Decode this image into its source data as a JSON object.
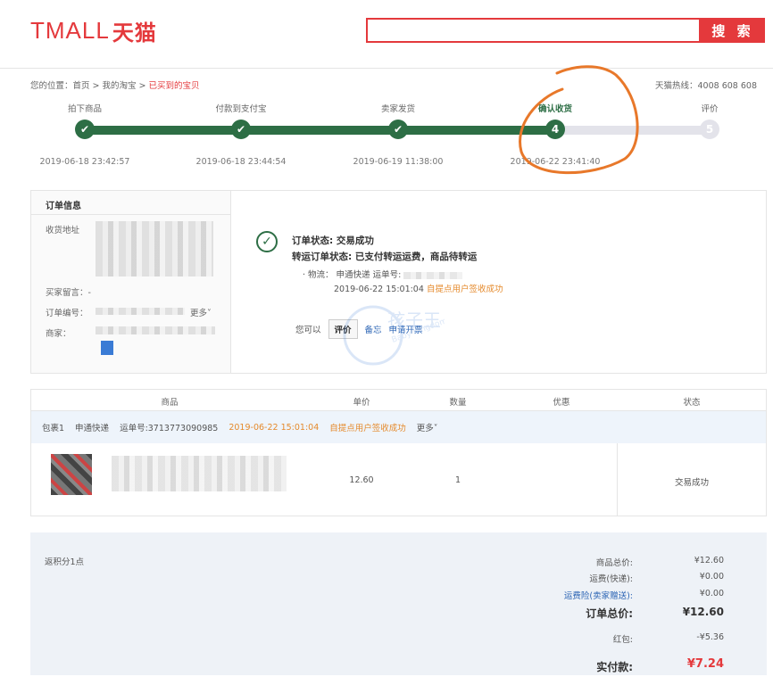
{
  "header": {
    "logo_latin": "TMALL",
    "logo_cn": "天猫",
    "search_placeholder": "",
    "search_button": "搜 索"
  },
  "breadcrumb": {
    "prefix": "您的位置：首页 > 我的淘宝 > ",
    "current": "已买到的宝贝",
    "hotline": "天猫热线：4008 608 608"
  },
  "steps": [
    {
      "label": "拍下商品",
      "time": "2019-06-18 23:42:57",
      "num": "✔",
      "done": true
    },
    {
      "label": "付款到支付宝",
      "time": "2019-06-18 23:44:54",
      "num": "✔",
      "done": true
    },
    {
      "label": "卖家发货",
      "time": "2019-06-19 11:38:00",
      "num": "✔",
      "done": true
    },
    {
      "label": "确认收货",
      "time": "2019-06-22 23:41:40",
      "num": "4",
      "done": true
    },
    {
      "label": "评价",
      "time": "",
      "num": "5",
      "done": false
    }
  ],
  "order_info": {
    "title": "订单信息",
    "address_label": "收货地址",
    "message_label": "买家留言：-",
    "order_no_label": "订单编号：",
    "more": "更多˅",
    "merchant_label": "商家："
  },
  "status": {
    "line1": "订单状态: 交易成功",
    "line2": "转运订单状态: 已支付转运运费，商品待转运",
    "logistics_prefix": "· 物流： 申通快递  运单号:",
    "logistics_time": "2019-06-22 15:01:04",
    "logistics_status": "自提点用户签收成功",
    "you_can": "您可以",
    "btn_eval": "评价",
    "link_memo": "备忘",
    "link_invoice": "申请开票"
  },
  "table": {
    "headers": [
      "商品",
      "单价",
      "数量",
      "优惠",
      "状态"
    ],
    "package": {
      "label": "包裹1",
      "carrier": "申通快递",
      "tracking": "运单号:3713773090985",
      "time": "2019-06-22 15:01:04",
      "status": "自提点用户签收成功",
      "more": "更多˅"
    },
    "row": {
      "price": "12.60",
      "qty": "1",
      "discount": "",
      "status": "交易成功"
    }
  },
  "summary": {
    "points": "返积分1点",
    "items": [
      {
        "label": "商品总价:",
        "value": "¥12.60"
      },
      {
        "label": "运费(快递):",
        "value": "¥0.00"
      },
      {
        "label": "运费险(卖家赠送):",
        "value": "¥0.00"
      },
      {
        "label": "订单总价:",
        "value": "¥12.60"
      },
      {
        "label": "红包:",
        "value": "-¥5.36"
      },
      {
        "label": "实付款:",
        "value": "¥7.24"
      }
    ]
  },
  "watermark": {
    "cn": "孩子王",
    "en": "Baby Kingdom"
  },
  "colors": {
    "brand": "#e4393c",
    "progress": "#2d6e45",
    "link": "#2b64b4",
    "highlight": "#e58a2c"
  }
}
